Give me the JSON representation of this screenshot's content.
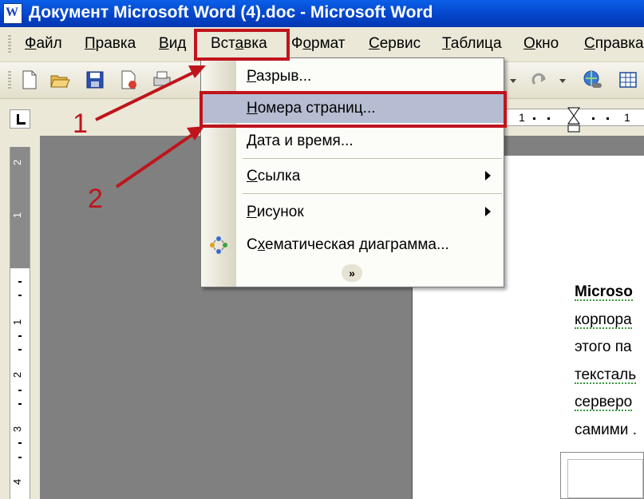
{
  "window": {
    "title": "Документ Microsoft Word (4).doc - Microsoft Word"
  },
  "menubar": {
    "items": [
      {
        "pre": "",
        "ul": "Ф",
        "post": "айл"
      },
      {
        "pre": "",
        "ul": "П",
        "post": "равка"
      },
      {
        "pre": "",
        "ul": "В",
        "post": "ид"
      },
      {
        "pre": "Вст",
        "ul": "а",
        "post": "вка"
      },
      {
        "pre": "Ф",
        "ul": "о",
        "post": "рмат"
      },
      {
        "pre": "",
        "ul": "С",
        "post": "ервис"
      },
      {
        "pre": "",
        "ul": "Т",
        "post": "аблица"
      },
      {
        "pre": "",
        "ul": "О",
        "post": "кно"
      },
      {
        "pre": "",
        "ul": "С",
        "post": "правка"
      }
    ]
  },
  "dropdown": {
    "items": [
      {
        "pre": "",
        "ul": "Р",
        "post": "азрыв..."
      },
      {
        "pre": "",
        "ul": "Н",
        "post": "омера страниц..."
      },
      {
        "pre": "",
        "ul": "Д",
        "post": "ата и время..."
      },
      {
        "pre": "",
        "ul": "С",
        "post": "сылка"
      },
      {
        "pre": "",
        "ul": "Р",
        "post": "исунок"
      },
      {
        "pre": "С",
        "ul": "х",
        "post": "ематическая диаграмма..."
      }
    ],
    "expand_glyph": "»"
  },
  "ruler": {
    "horizontal_marks": [
      "1",
      "1"
    ],
    "vertical_numbers": [
      "2",
      "1",
      "1",
      "2",
      "3",
      "4"
    ]
  },
  "document": {
    "lines": [
      "Microso",
      "корпора",
      "этого па",
      "тексталь",
      "серверо",
      "самими ."
    ]
  },
  "annotations": {
    "label_1": "1",
    "label_2": "2"
  },
  "colors": {
    "annotation_red": "#c0141c",
    "menu_highlight": "#b6bdd2",
    "titlebar": "#0443c8"
  }
}
